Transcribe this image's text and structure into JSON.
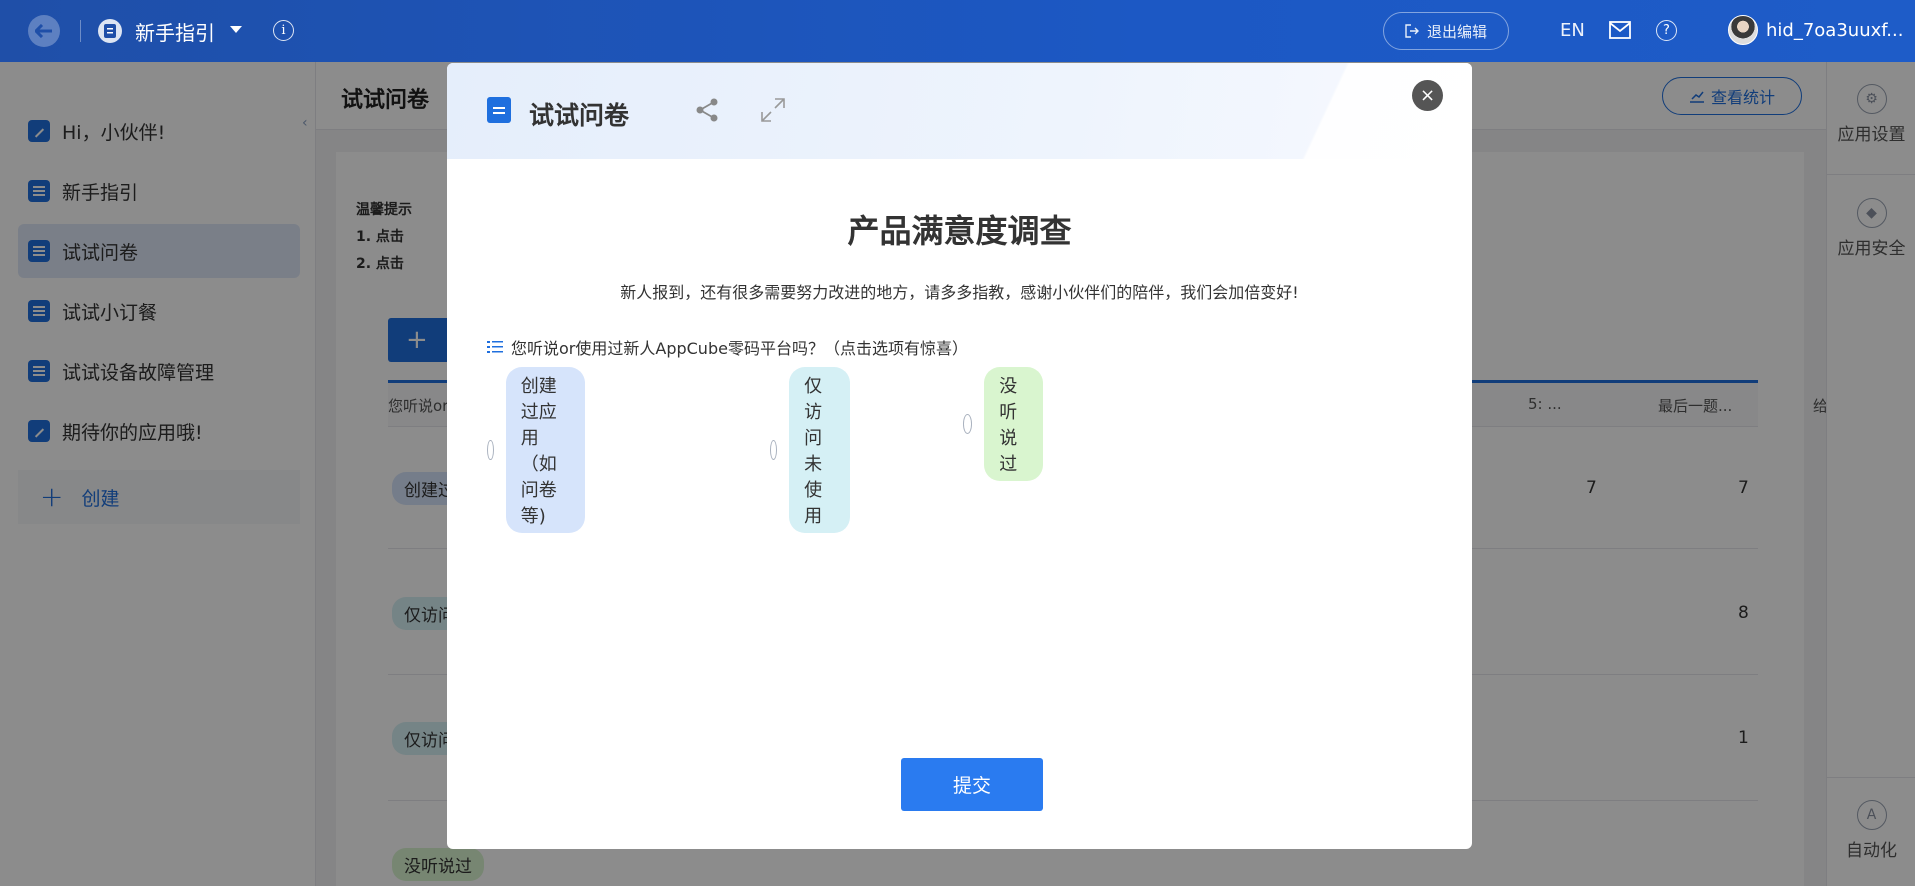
{
  "topbar": {
    "app_title": "新手指引",
    "exit_edit": "退出编辑",
    "lang": "EN",
    "username": "hid_7oa3uuxf..."
  },
  "sidebar": {
    "items": [
      {
        "label": "Hi，小伙伴!",
        "icon": "pen-icon"
      },
      {
        "label": "新手指引",
        "icon": "doc-icon"
      },
      {
        "label": "试试问卷",
        "icon": "doc-icon",
        "active": true
      },
      {
        "label": "试试小订餐",
        "icon": "doc-icon"
      },
      {
        "label": "试试设备故障管理",
        "icon": "doc-icon"
      },
      {
        "label": "期待你的应用哦!",
        "icon": "pen-icon"
      }
    ],
    "create_label": "创建"
  },
  "main": {
    "title": "试试问卷",
    "stats_label": "查看统计",
    "tip_title": "温馨提示",
    "tip_line1": "1. 点击",
    "tip_line2": "2. 点击",
    "add_label": "+",
    "columns": [
      "您听说or",
      "5: ...",
      "最后一题...",
      "给"
    ],
    "rows": [
      {
        "tag": "创建过",
        "c1": "7",
        "c2": "7"
      },
      {
        "tag": "仅访问",
        "c1": "",
        "c2": "8"
      },
      {
        "tag": "仅访问",
        "c1": "",
        "c2": "1"
      },
      {
        "tag": "没听说过",
        "c1": "",
        "c2": ""
      }
    ]
  },
  "rail": {
    "items": [
      "应用设置",
      "应用安全",
      "自动化"
    ]
  },
  "modal": {
    "title": "试试问卷",
    "close": "×",
    "survey_title": "产品满意度调查",
    "survey_desc": "新人报到，还有很多需要努力改进的地方，请多多指教，感谢小伙伴们的陪伴，我们会加倍变好!",
    "question": "您听说or使用过新人AppCube零码平台吗？（点击选项有惊喜）",
    "options": [
      {
        "label": "创建过应用（如问卷等)",
        "color": "#d6e4fb"
      },
      {
        "label": "仅访问未使用",
        "color": "#d5f0f5"
      },
      {
        "label": "没听说过",
        "color": "#d9f5cf"
      }
    ],
    "submit": "提交"
  },
  "colors": {
    "primary": "#1f6fde",
    "topbar": "#1f4fa8"
  }
}
